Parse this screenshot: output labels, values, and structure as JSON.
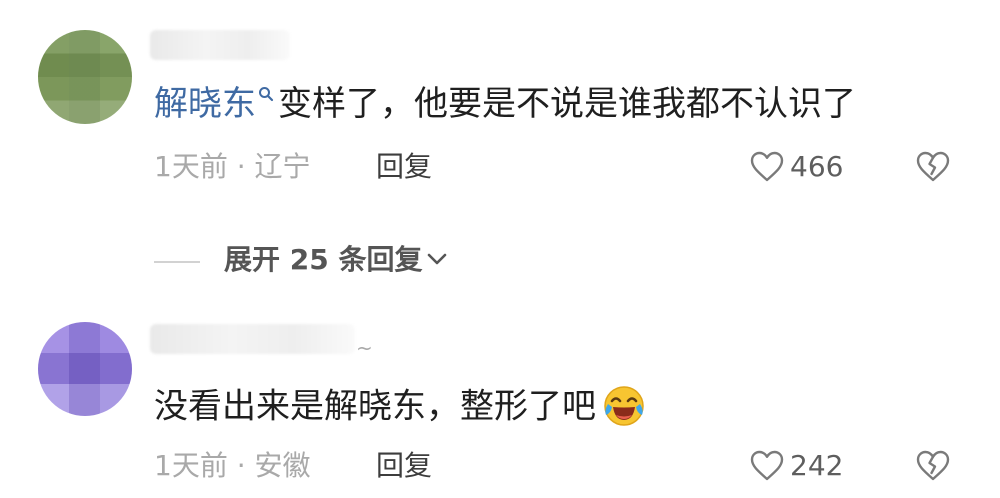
{
  "comments": [
    {
      "text": "变样了，他要是不说是谁我都不认识了",
      "mention": "解晓东",
      "time_location": "1天前 · 辽宁",
      "reply_label": "回复",
      "likes": "466",
      "avatar_icon": "blurred-avatar-green"
    },
    {
      "username_suffix": "~",
      "text": "没看出来是解晓东，整形了吧",
      "emoji": "laughing-crying-emoji",
      "time_location": "1天前 · 安徽",
      "reply_label": "回复",
      "likes": "242",
      "avatar_icon": "blurred-avatar-purple"
    }
  ],
  "expand_replies_label": "展开 25 条回复",
  "colors": {
    "mention": "#3f6aa3",
    "text": "#1f1f1f",
    "meta": "#a9a9a9",
    "reply": "#3d3d3d"
  }
}
